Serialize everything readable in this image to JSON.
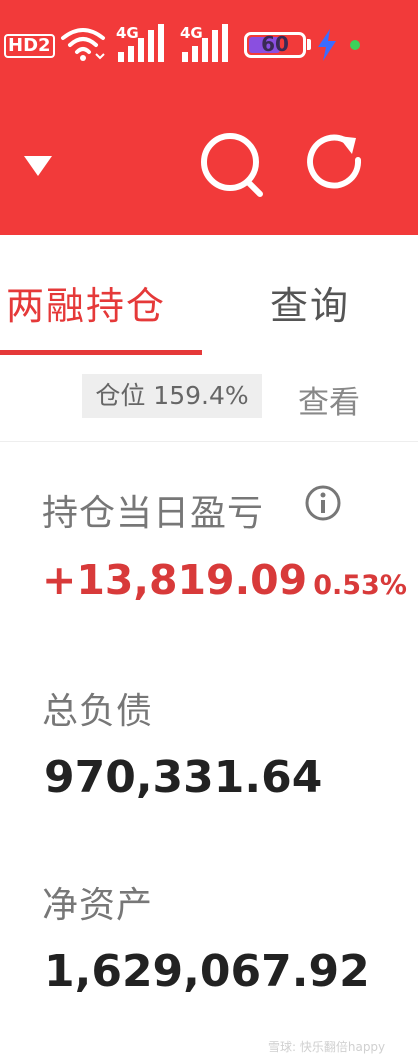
{
  "status_bar": {
    "hd_label": "HD2",
    "network1": "4G",
    "network2": "4G",
    "battery_level": "60",
    "battery_percent": 60,
    "colors": {
      "bar": "#f23a3a",
      "battery_fill": "#8a4fe0",
      "charging": "#3b6cff",
      "indicator": "#3cd15a"
    }
  },
  "toolbar": {
    "icons": [
      "dropdown-triangle-icon",
      "search-icon",
      "refresh-icon"
    ]
  },
  "tabs": [
    {
      "label": "两融持仓",
      "active": true
    },
    {
      "label": "查询",
      "active": false
    }
  ],
  "position": {
    "badge": "仓位 159.4%",
    "view_label": "查看"
  },
  "summary": {
    "daily_pl_label": "持仓当日盈亏",
    "daily_pl_value": "+13,819.09",
    "daily_pl_pct": "0.53%",
    "total_liabilities_label": "总负债",
    "total_liabilities_value": "970,331.64",
    "net_assets_label": "净资产",
    "net_assets_value": "1,629,067.92"
  },
  "watermark": "雪球: 快乐翻倍happy",
  "colors": {
    "accent": "#e53939",
    "gain": "#d83a3a"
  }
}
